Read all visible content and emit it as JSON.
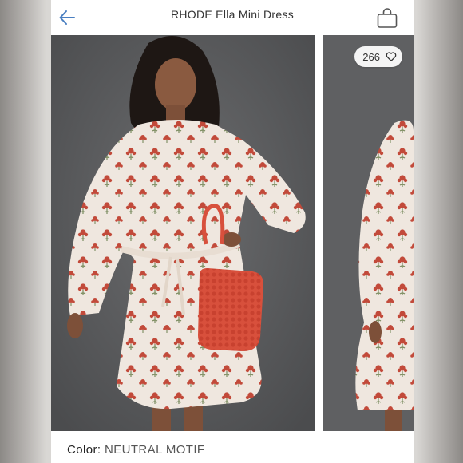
{
  "header": {
    "title": "RHODE Ella Mini Dress",
    "back_icon": "arrow-left-icon",
    "bag_icon": "shopping-bag-icon"
  },
  "gallery": {
    "likes_count": "266",
    "like_icon": "heart-icon"
  },
  "product": {
    "color_label": "Color:",
    "color_value": "NEUTRAL MOTIF"
  },
  "colors": {
    "accent": "#4a7fc1",
    "photo_background": "#5d5e60",
    "dress_base": "#efe7df",
    "dress_print": "#c24a3a",
    "bag": "#d8503c"
  }
}
